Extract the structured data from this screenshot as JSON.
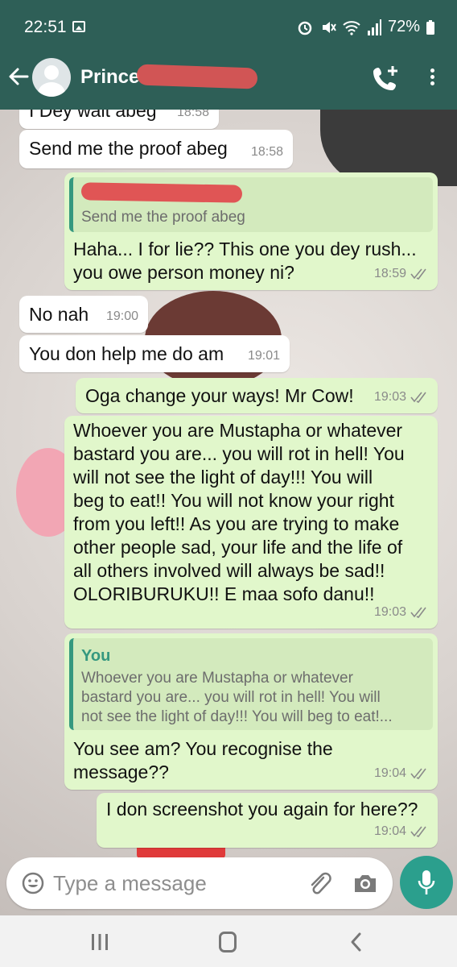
{
  "status_bar": {
    "time": "22:51",
    "battery": "72%"
  },
  "header": {
    "contact_name": "Prince"
  },
  "messages": [
    {
      "text": "I Dey wait abeg",
      "time": "18:58"
    },
    {
      "text": "Send me the proof abeg",
      "time": "18:58"
    },
    {
      "quoted_text": "Send me the proof abeg",
      "text_line1": "Haha... I for lie?? This one you dey rush...",
      "text_line2": "you owe person money ni?",
      "time": "18:59"
    },
    {
      "text": "No nah",
      "time": "19:00"
    },
    {
      "text": "You don help me do am",
      "time": "19:01"
    },
    {
      "text": "Oga change your ways! Mr Cow!",
      "time": "19:03"
    },
    {
      "lines": [
        "Whoever you are Mustapha or whatever",
        "bastard you are... you will rot in hell! You",
        "will not see the light of day!!! You will",
        "beg to eat!! You will not know your right",
        "from you left!! As you are trying to make",
        "other people sad, your life and the life of",
        "all others involved will always be sad!!",
        "OLORIBURUKU!! E maa sofo danu!!"
      ],
      "time": "19:03"
    },
    {
      "quoted_author": "You",
      "quoted_lines": [
        "Whoever you are Mustapha or whatever",
        "bastard you are... you will rot in hell! You will",
        "not see the light of day!!! You will beg to eat!..."
      ],
      "text_line1": "You see am? You recognise the",
      "text_line2": "message??",
      "time": "19:04"
    },
    {
      "text": "I don screenshot you again for here??",
      "time": "19:04"
    }
  ],
  "composer": {
    "placeholder": "Type a message"
  },
  "icons": {
    "back": "back-arrow-icon",
    "call": "add-call-icon",
    "menu": "more-vert-icon",
    "emoji": "emoji-icon",
    "attach": "paperclip-icon",
    "camera": "camera-icon",
    "mic": "mic-icon"
  },
  "colors": {
    "header": "#2e5f57",
    "outgoing_bubble": "#e1f7cb",
    "incoming_bubble": "#ffffff",
    "accent": "#2b9f8d",
    "tick": "#8a8a8a"
  }
}
